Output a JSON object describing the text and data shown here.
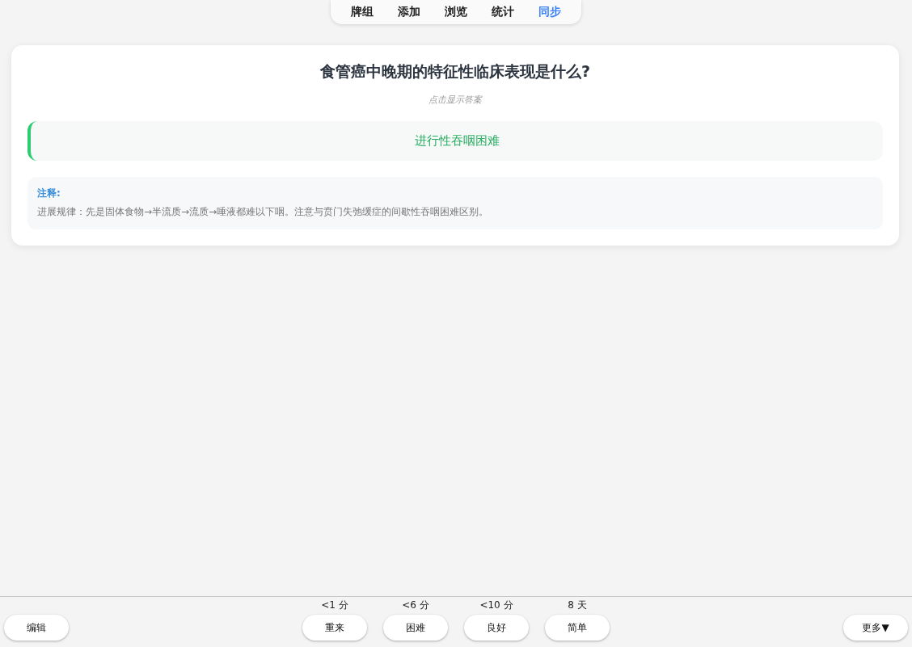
{
  "tabs": [
    {
      "label": "牌组",
      "selected": false
    },
    {
      "label": "添加",
      "selected": false
    },
    {
      "label": "浏览",
      "selected": false
    },
    {
      "label": "统计",
      "selected": false
    },
    {
      "label": "同步",
      "selected": true
    }
  ],
  "card": {
    "question": "食管癌中晚期的特征性临床表现是什么?",
    "hint": "点击显示答案",
    "answer": "进行性吞咽困难",
    "note": {
      "title": "注释:",
      "text": "进展规律：先是固体食物→半流质→流质→唾液都难以下咽。注意与贲门失弛缓症的间歇性吞咽困难区别。"
    }
  },
  "bottom_bar": {
    "edit_button": "编辑",
    "answer_buttons": [
      {
        "interval": "<1 分",
        "label": "重来"
      },
      {
        "interval": "<6 分",
        "label": "困难"
      },
      {
        "interval": "<10 分",
        "label": "良好"
      },
      {
        "interval": "8 天",
        "label": "简单"
      }
    ],
    "more_button": "更多▼"
  }
}
